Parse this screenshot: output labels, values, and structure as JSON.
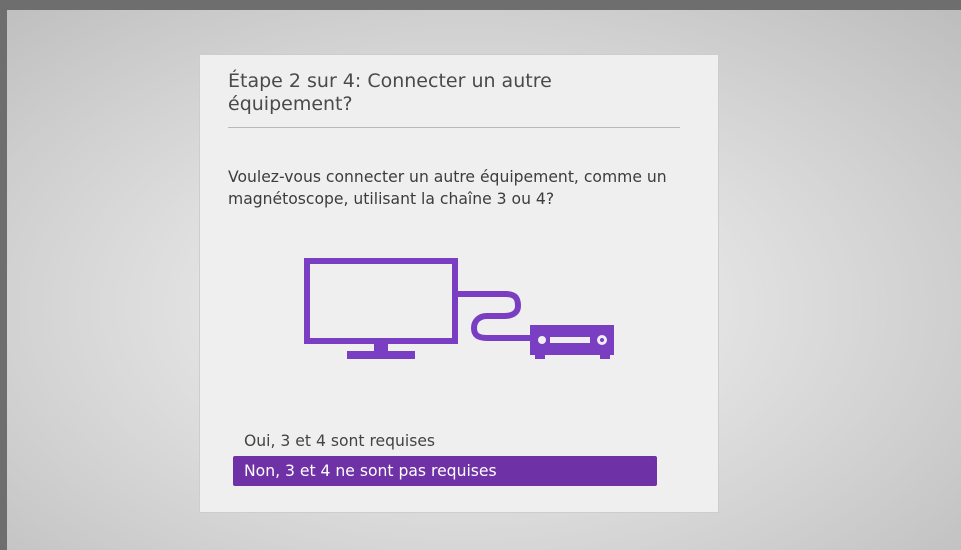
{
  "dialog": {
    "title": "Étape 2 sur 4: Connecter un autre équipement?",
    "question": "Voulez-vous connecter un autre équipement, comme un magnétoscope, utilisant la chaîne 3 ou 4?"
  },
  "illustration": {
    "icon": "tv-connected-to-vcr-icon",
    "color": "#7a3ec2"
  },
  "options": [
    {
      "label": "Oui, 3 et 4 sont requises",
      "selected": false
    },
    {
      "label": "Non, 3 et 4 ne sont pas requises",
      "selected": true
    }
  ],
  "colors": {
    "accent": "#6f31a6",
    "dialog_background": "#efefef",
    "text": "#444444"
  }
}
